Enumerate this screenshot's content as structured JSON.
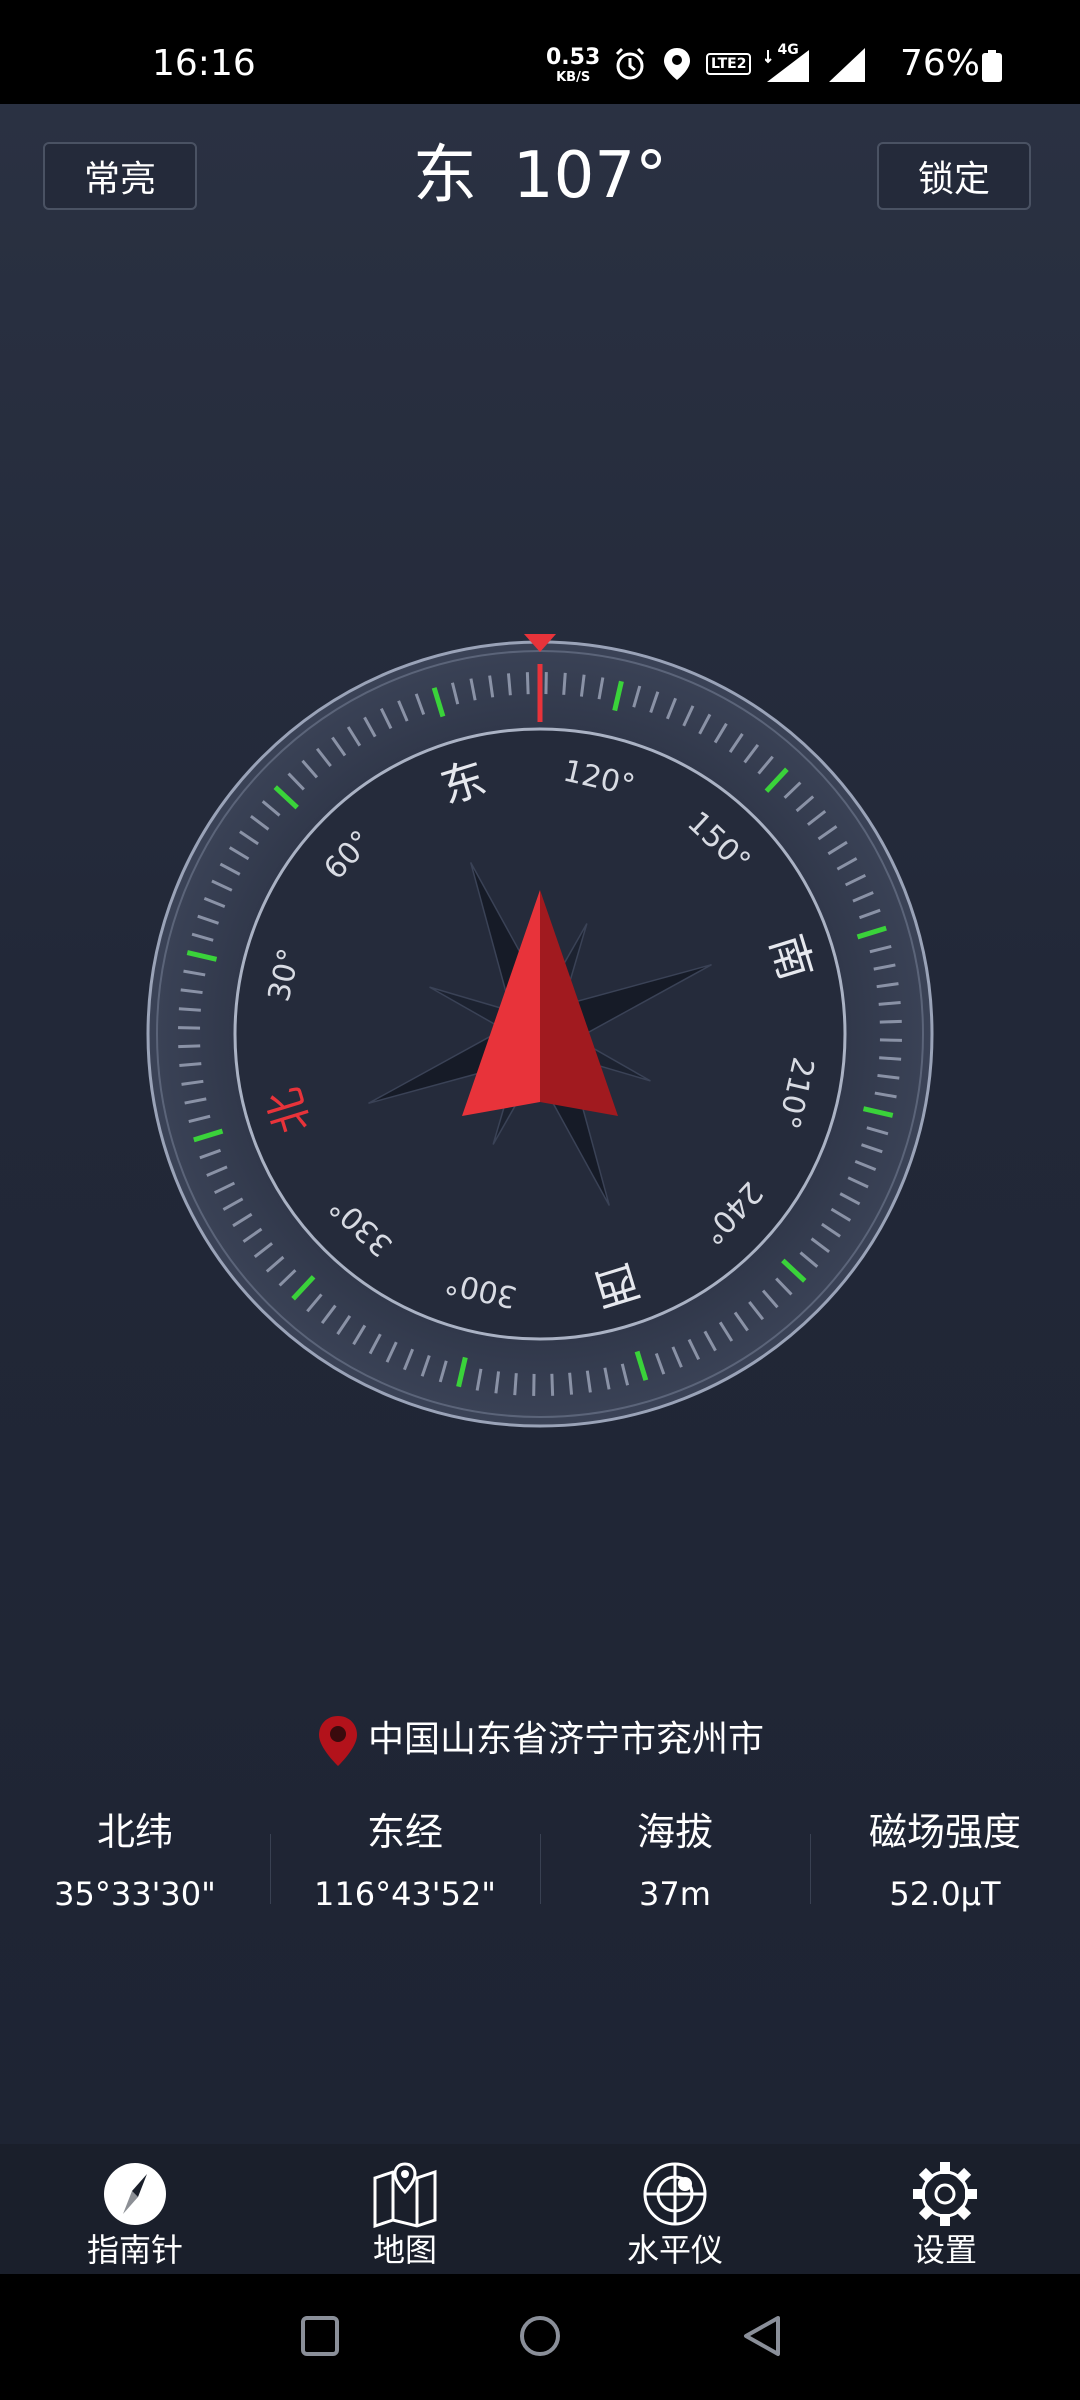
{
  "status_bar": {
    "time": "16:16",
    "net_speed_value": "0.53",
    "net_speed_unit": "KB/S",
    "lte_badge": "LTE2",
    "network_type": "4G",
    "battery": "76%"
  },
  "header": {
    "left_button": "常亮",
    "right_button": "锁定",
    "direction": "东",
    "degrees": "107°"
  },
  "compass": {
    "heading_deg": 107,
    "cardinals": {
      "north": "北",
      "east": "东",
      "south": "南",
      "west": "西"
    },
    "degree_labels": [
      "30°",
      "60°",
      "120°",
      "150°",
      "210°",
      "240°",
      "300°",
      "330°"
    ],
    "colors": {
      "pointer": "#e8333a",
      "pointer_dark": "#a11a1f",
      "major_tick": "#3ad33a",
      "tick": "#8a92a6"
    }
  },
  "location": {
    "address": "中国山东省济宁市兖州市"
  },
  "stats": [
    {
      "label": "北纬",
      "value": "35°33'30\""
    },
    {
      "label": "东经",
      "value": "116°43'52\""
    },
    {
      "label": "海拔",
      "value": "37m"
    },
    {
      "label": "磁场强度",
      "value": "52.0μT"
    }
  ],
  "bottom_nav": [
    {
      "label": "指南针",
      "icon": "compass-icon",
      "active": true
    },
    {
      "label": "地图",
      "icon": "map-icon"
    },
    {
      "label": "水平仪",
      "icon": "level-icon"
    },
    {
      "label": "设置",
      "icon": "gear-icon"
    }
  ]
}
